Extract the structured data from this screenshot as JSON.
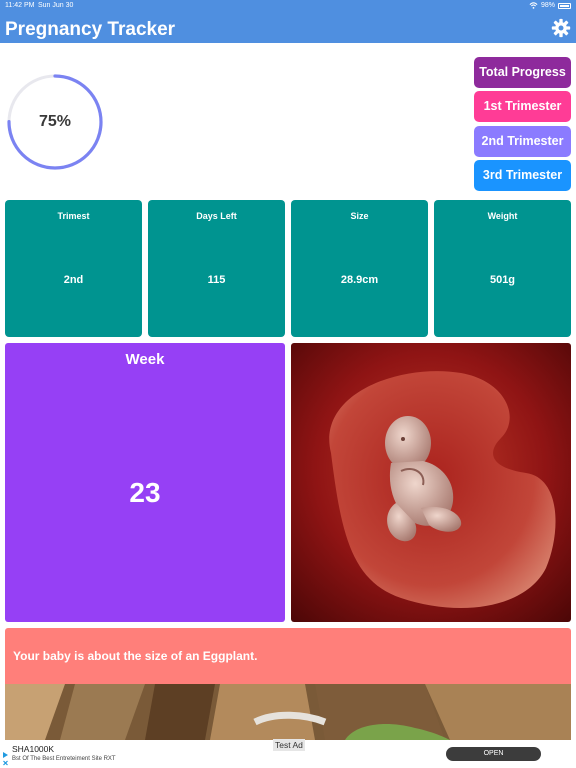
{
  "status_bar": {
    "time": "11:42 PM",
    "date": "Sun Jun 30",
    "battery": "98%"
  },
  "nav": {
    "title": "Pregnancy Tracker",
    "settings_icon": "gear-icon"
  },
  "progress": {
    "label": "75%",
    "value": 0.75,
    "color": "#7b83f2"
  },
  "trimester_buttons": [
    {
      "label": "Total Progress",
      "color": "#8e2a9c"
    },
    {
      "label": "1st Trimester",
      "color": "#ff3c96"
    },
    {
      "label": "2nd Trimester",
      "color": "#8b7bff"
    },
    {
      "label": "3rd Trimester",
      "color": "#1a94ff"
    }
  ],
  "stats": [
    {
      "label": "Trimest",
      "value": "2nd"
    },
    {
      "label": "Days Left",
      "value": "115"
    },
    {
      "label": "Size",
      "value": "28.9cm"
    },
    {
      "label": "Weight",
      "value": "501g"
    }
  ],
  "week": {
    "label": "Week",
    "value": "23"
  },
  "size_message": "Your baby is about the size of an Eggplant.",
  "ad": {
    "tag": "Test Ad",
    "title": "SHA1000K",
    "subtitle": "Bst Of The Best Entreteiment Site RXT",
    "cta": "OPEN"
  },
  "colors": {
    "nav": "#4f8fe0",
    "stat_card": "#009490",
    "week_card": "#9640f5",
    "banner": "#ff7f7a"
  }
}
